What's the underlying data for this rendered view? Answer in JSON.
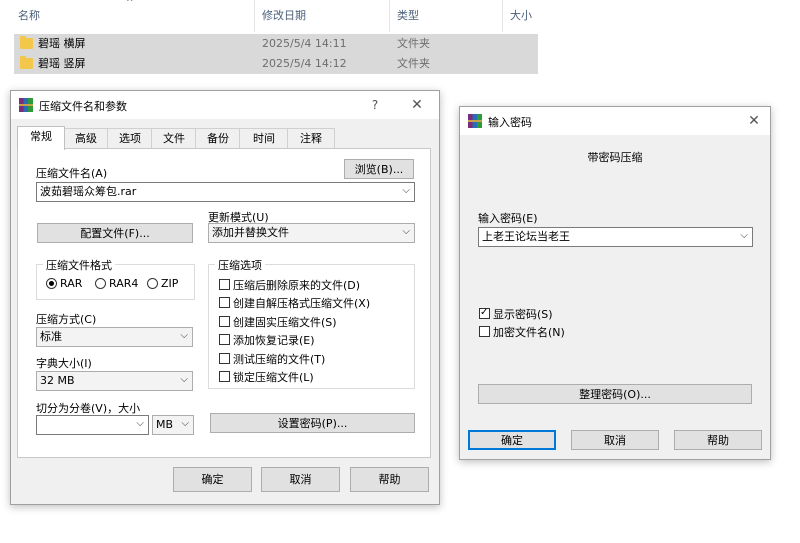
{
  "explorer": {
    "columns": [
      "名称",
      "修改日期",
      "类型",
      "大小"
    ],
    "rows": [
      {
        "name": "碧瑶 横屏",
        "date": "2025/5/4 14:11",
        "type": "文件夹"
      },
      {
        "name": "碧瑶 竖屏",
        "date": "2025/5/4 14:12",
        "type": "文件夹"
      }
    ]
  },
  "archive_dialog": {
    "title": "压缩文件名和参数",
    "help": "?",
    "close": "✕",
    "tabs": [
      "常规",
      "高级",
      "选项",
      "文件",
      "备份",
      "时间",
      "注释"
    ],
    "archive_name_label": "压缩文件名(A)",
    "browse_label": "浏览(B)...",
    "archive_name_value": "波茹碧瑶众筹包.rar",
    "update_mode_label": "更新模式(U)",
    "update_mode_value": "添加并替换文件",
    "profiles_label": "配置文件(F)...",
    "format_group": "压缩文件格式",
    "format_rar": "RAR",
    "format_rar4": "RAR4",
    "format_zip": "ZIP",
    "options_group": "压缩选项",
    "options": [
      "压缩后删除原来的文件(D)",
      "创建自解压格式压缩文件(X)",
      "创建固实压缩文件(S)",
      "添加恢复记录(E)",
      "测试压缩的文件(T)",
      "锁定压缩文件(L)"
    ],
    "method_label": "压缩方式(C)",
    "method_value": "标准",
    "dict_label": "字典大小(I)",
    "dict_value": "32 MB",
    "split_label": "切分为分卷(V)，大小",
    "split_value": "",
    "split_unit": "MB",
    "set_password_label": "设置密码(P)...",
    "ok": "确定",
    "cancel": "取消",
    "help_btn": "帮助"
  },
  "password_dialog": {
    "title": "输入密码",
    "close": "✕",
    "heading": "带密码压缩",
    "enter_label": "输入密码(E)",
    "password_value": "上老王论坛当老王",
    "show_password": "显示密码(S)",
    "encrypt_names": "加密文件名(N)",
    "organize_label": "整理密码(O)...",
    "ok": "确定",
    "cancel": "取消",
    "help_btn": "帮助"
  }
}
